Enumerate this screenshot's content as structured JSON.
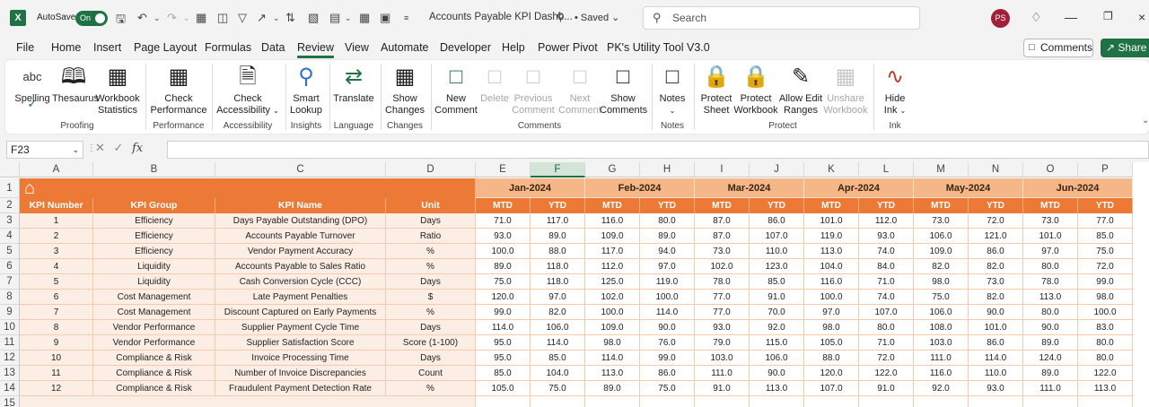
{
  "titlebar": {
    "app_icon": "X",
    "autosave_label": "AutoSave",
    "autosave_state": "On",
    "doc_title": "Accounts Payable KPI Dashb...",
    "saved_status": "• Saved",
    "search_placeholder": "Search",
    "avatar_initials": "PS"
  },
  "menu": {
    "tabs": [
      "File",
      "Home",
      "Insert",
      "Page Layout",
      "Formulas",
      "Data",
      "Review",
      "View",
      "Automate",
      "Developer",
      "Help",
      "Power Pivot",
      "PK's Utility Tool V3.0"
    ],
    "active_tab": "Review",
    "comments_button": "Comments",
    "share_button": "Share"
  },
  "ribbon": {
    "buttons": {
      "spelling": "Spelling",
      "thesaurus": "Thesaurus",
      "workbook_statistics_1": "Workbook",
      "workbook_statistics_2": "Statistics",
      "check_performance_1": "Check",
      "check_performance_2": "Performance",
      "check_accessibility_1": "Check",
      "check_accessibility_2": "Accessibility",
      "smart_lookup_1": "Smart",
      "smart_lookup_2": "Lookup",
      "translate": "Translate",
      "show_changes_1": "Show",
      "show_changes_2": "Changes",
      "new_comment_1": "New",
      "new_comment_2": "Comment",
      "delete": "Delete",
      "previous_comment_1": "Previous",
      "previous_comment_2": "Comment",
      "next_comment_1": "Next",
      "next_comment_2": "Comment",
      "show_comments_1": "Show",
      "show_comments_2": "Comments",
      "notes": "Notes",
      "protect_sheet_1": "Protect",
      "protect_sheet_2": "Sheet",
      "protect_workbook_1": "Protect",
      "protect_workbook_2": "Workbook",
      "allow_edit_ranges_1": "Allow Edit",
      "allow_edit_ranges_2": "Ranges",
      "unshare_workbook_1": "Unshare",
      "unshare_workbook_2": "Workbook",
      "hide_ink_1": "Hide",
      "hide_ink_2": "Ink"
    },
    "groups": {
      "proofing": "Proofing",
      "performance": "Performance",
      "accessibility": "Accessibility",
      "insights": "Insights",
      "language": "Language",
      "changes": "Changes",
      "comments": "Comments",
      "notes": "Notes",
      "protect": "Protect",
      "ink": "Ink"
    }
  },
  "formula_bar": {
    "name_box": "F23",
    "fx": "fx",
    "formula": ""
  },
  "sheet": {
    "columns": [
      "A",
      "B",
      "C",
      "D",
      "E",
      "F",
      "G",
      "H",
      "I",
      "J",
      "K",
      "L",
      "M",
      "N",
      "O",
      "P"
    ],
    "selected_column": "F",
    "row_numbers": [
      "1",
      "2",
      "3",
      "4",
      "5",
      "6",
      "7",
      "8",
      "9",
      "10",
      "11",
      "12",
      "13",
      "14",
      "15"
    ],
    "months": [
      "Jan-2024",
      "Feb-2024",
      "Mar-2024",
      "Apr-2024",
      "May-2024",
      "Jun-2024"
    ],
    "header_row": {
      "kpi_number": "KPI Number",
      "kpi_group": "KPI Group",
      "kpi_name": "KPI Name",
      "unit": "Unit",
      "mtd": "MTD",
      "ytd": "YTD"
    },
    "rows": [
      {
        "num": "1",
        "group": "Efficiency",
        "name": "Days Payable Outstanding (DPO)",
        "unit": "Days",
        "values": [
          "71.0",
          "117.0",
          "116.0",
          "80.0",
          "87.0",
          "86.0",
          "101.0",
          "112.0",
          "73.0",
          "72.0",
          "73.0",
          "77.0"
        ]
      },
      {
        "num": "2",
        "group": "Efficiency",
        "name": "Accounts Payable Turnover",
        "unit": "Ratio",
        "values": [
          "93.0",
          "89.0",
          "109.0",
          "89.0",
          "87.0",
          "107.0",
          "119.0",
          "93.0",
          "106.0",
          "121.0",
          "101.0",
          "85.0"
        ]
      },
      {
        "num": "3",
        "group": "Efficiency",
        "name": "Vendor Payment Accuracy",
        "unit": "%",
        "values": [
          "100.0",
          "88.0",
          "117.0",
          "94.0",
          "73.0",
          "110.0",
          "113.0",
          "74.0",
          "109.0",
          "86.0",
          "97.0",
          "75.0"
        ]
      },
      {
        "num": "4",
        "group": "Liquidity",
        "name": "Accounts Payable to Sales Ratio",
        "unit": "%",
        "values": [
          "89.0",
          "118.0",
          "112.0",
          "97.0",
          "102.0",
          "123.0",
          "104.0",
          "84.0",
          "82.0",
          "82.0",
          "80.0",
          "72.0"
        ]
      },
      {
        "num": "5",
        "group": "Liquidity",
        "name": "Cash Conversion Cycle (CCC)",
        "unit": "Days",
        "values": [
          "75.0",
          "118.0",
          "125.0",
          "119.0",
          "78.0",
          "85.0",
          "116.0",
          "71.0",
          "98.0",
          "73.0",
          "78.0",
          "99.0"
        ]
      },
      {
        "num": "6",
        "group": "Cost Management",
        "name": "Late Payment Penalties",
        "unit": "$",
        "values": [
          "120.0",
          "97.0",
          "102.0",
          "100.0",
          "77.0",
          "91.0",
          "100.0",
          "74.0",
          "75.0",
          "82.0",
          "113.0",
          "98.0"
        ]
      },
      {
        "num": "7",
        "group": "Cost Management",
        "name": "Discount Captured on Early Payments",
        "unit": "%",
        "values": [
          "99.0",
          "82.0",
          "100.0",
          "114.0",
          "77.0",
          "70.0",
          "97.0",
          "107.0",
          "106.0",
          "90.0",
          "80.0",
          "100.0"
        ]
      },
      {
        "num": "8",
        "group": "Vendor Performance",
        "name": "Supplier Payment Cycle Time",
        "unit": "Days",
        "values": [
          "114.0",
          "106.0",
          "109.0",
          "90.0",
          "93.0",
          "92.0",
          "98.0",
          "80.0",
          "108.0",
          "101.0",
          "90.0",
          "83.0"
        ]
      },
      {
        "num": "9",
        "group": "Vendor Performance",
        "name": "Supplier Satisfaction Score",
        "unit": "Score (1-100)",
        "values": [
          "95.0",
          "114.0",
          "98.0",
          "76.0",
          "79.0",
          "115.0",
          "105.0",
          "71.0",
          "103.0",
          "86.0",
          "89.0",
          "80.0"
        ]
      },
      {
        "num": "10",
        "group": "Compliance & Risk",
        "name": "Invoice Processing Time",
        "unit": "Days",
        "values": [
          "95.0",
          "85.0",
          "114.0",
          "99.0",
          "103.0",
          "106.0",
          "88.0",
          "72.0",
          "111.0",
          "114.0",
          "124.0",
          "80.0"
        ]
      },
      {
        "num": "11",
        "group": "Compliance & Risk",
        "name": "Number of Invoice Discrepancies",
        "unit": "Count",
        "values": [
          "85.0",
          "104.0",
          "113.0",
          "86.0",
          "111.0",
          "90.0",
          "120.0",
          "122.0",
          "116.0",
          "110.0",
          "89.0",
          "122.0"
        ]
      },
      {
        "num": "12",
        "group": "Compliance & Risk",
        "name": "Fraudulent Payment Detection Rate",
        "unit": "%",
        "values": [
          "105.0",
          "75.0",
          "89.0",
          "75.0",
          "91.0",
          "113.0",
          "107.0",
          "91.0",
          "92.0",
          "93.0",
          "111.0",
          "113.0"
        ]
      }
    ]
  },
  "colors": {
    "excel_green": "#1f7244",
    "header_orange": "#ec7a36",
    "month_orange": "#f5b688",
    "left_fill": "#fdeee5"
  }
}
